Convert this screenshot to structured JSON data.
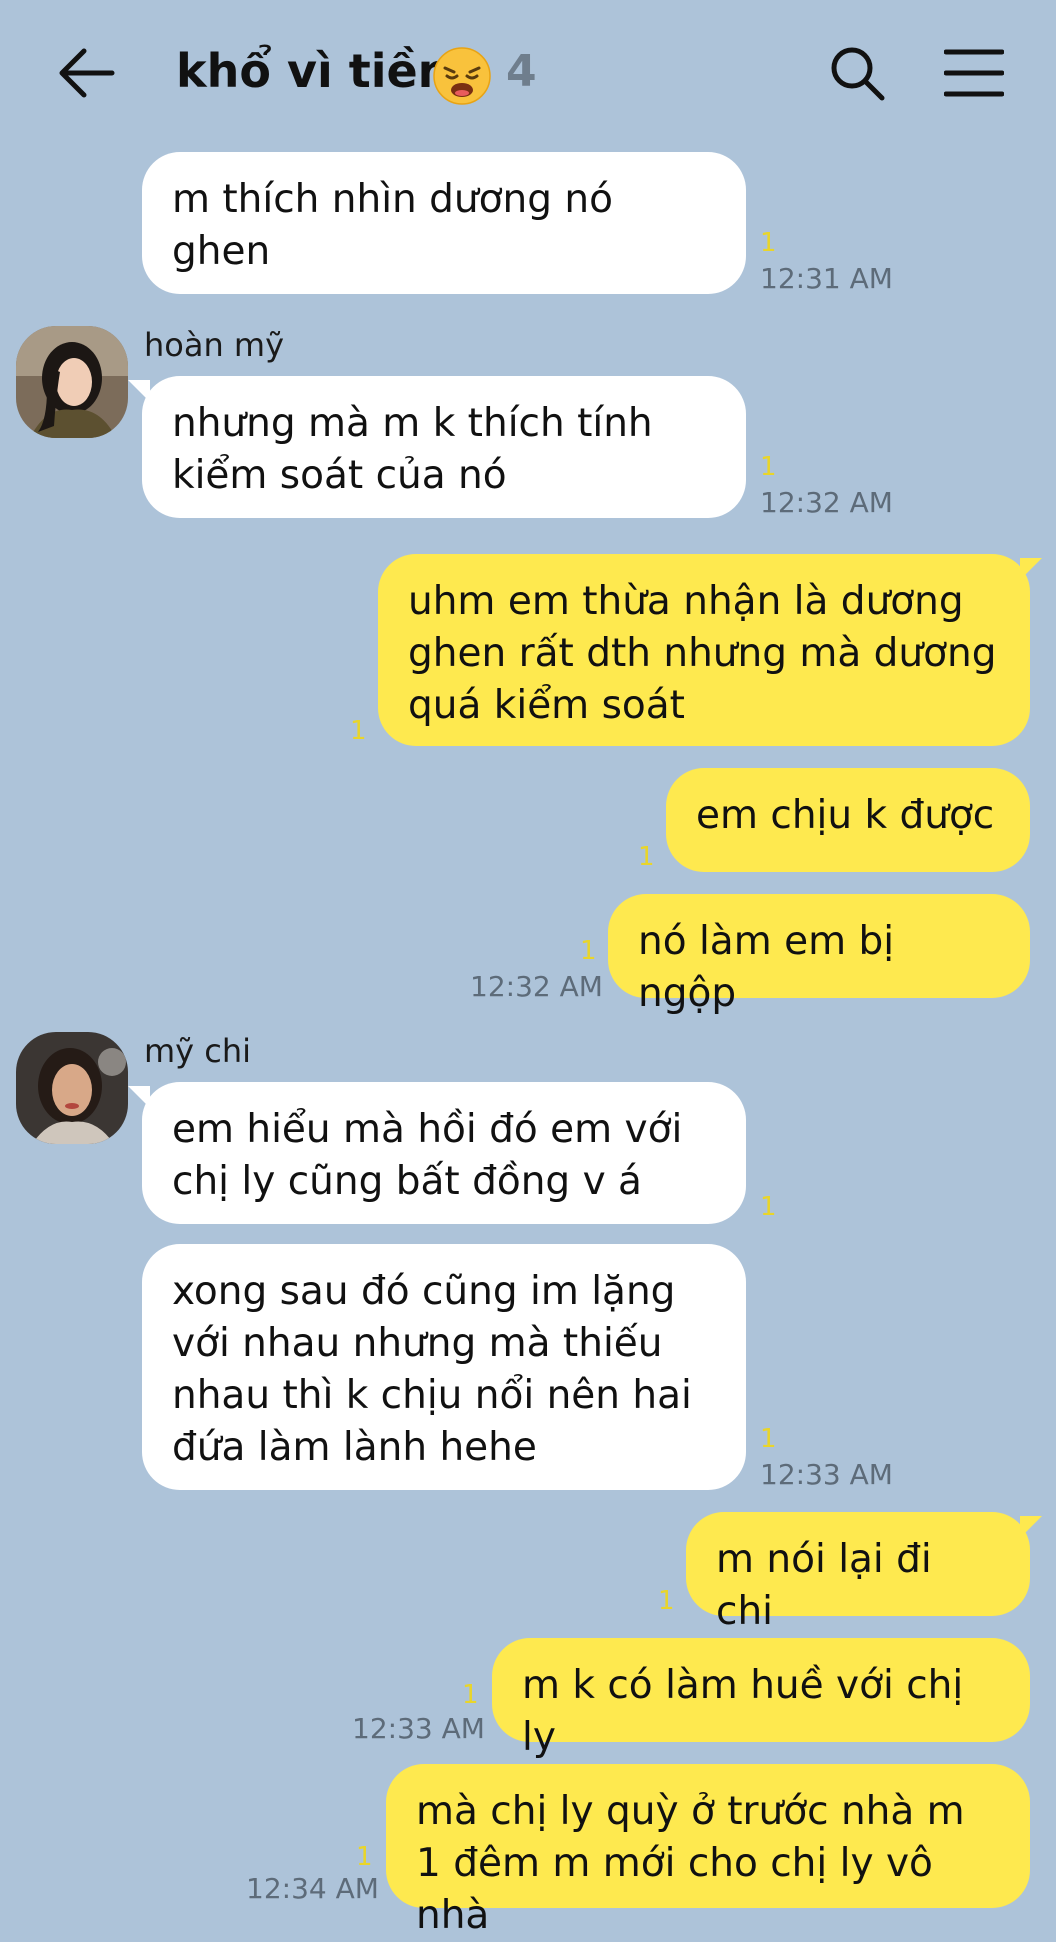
{
  "header": {
    "title": "khổ vì tiền",
    "emoji": "weary-face-emoji",
    "member_count": "4"
  },
  "icons": {
    "back": "back-arrow-icon",
    "search": "search-icon",
    "menu": "hamburger-menu-icon"
  },
  "colors": {
    "background": "#adc3d9",
    "incoming_bubble": "#ffffff",
    "outgoing_bubble": "#fee94f",
    "unread_marker": "#e9d52a"
  },
  "messages": [
    {
      "direction": "in",
      "text": "m thích nhìn dương nó ghen",
      "unread": "1",
      "time": "12:31 AM"
    },
    {
      "direction": "in",
      "sender": "hoàn mỹ",
      "text": "nhưng mà m k thích tính kiểm soát của nó",
      "unread": "1",
      "time": "12:32 AM"
    },
    {
      "direction": "out",
      "text": "uhm em thừa nhận là dương ghen rất dth nhưng mà dương quá kiểm soát",
      "unread": "1"
    },
    {
      "direction": "out",
      "text": "em chịu k được",
      "unread": "1"
    },
    {
      "direction": "out",
      "text": "nó làm em bị ngộp",
      "unread": "1",
      "time": "12:32 AM"
    },
    {
      "direction": "in",
      "sender": "mỹ chi",
      "text": "em hiểu mà hồi đó em với chị ly cũng bất đồng v á",
      "unread": "1"
    },
    {
      "direction": "in",
      "text": "xong sau đó cũng im lặng với nhau nhưng mà thiếu nhau thì k chịu nổi nên hai đứa làm lành hehe",
      "unread": "1",
      "time": "12:33 AM"
    },
    {
      "direction": "out",
      "text": "m nói lại đi chi",
      "unread": "1"
    },
    {
      "direction": "out",
      "text": "m k có làm huề với chị ly",
      "unread": "1",
      "time": "12:33 AM"
    },
    {
      "direction": "out",
      "text": "mà chị ly quỳ ở trước nhà m 1 đêm m mới cho chị ly vô nhà",
      "unread": "1",
      "time": "12:34 AM"
    }
  ]
}
